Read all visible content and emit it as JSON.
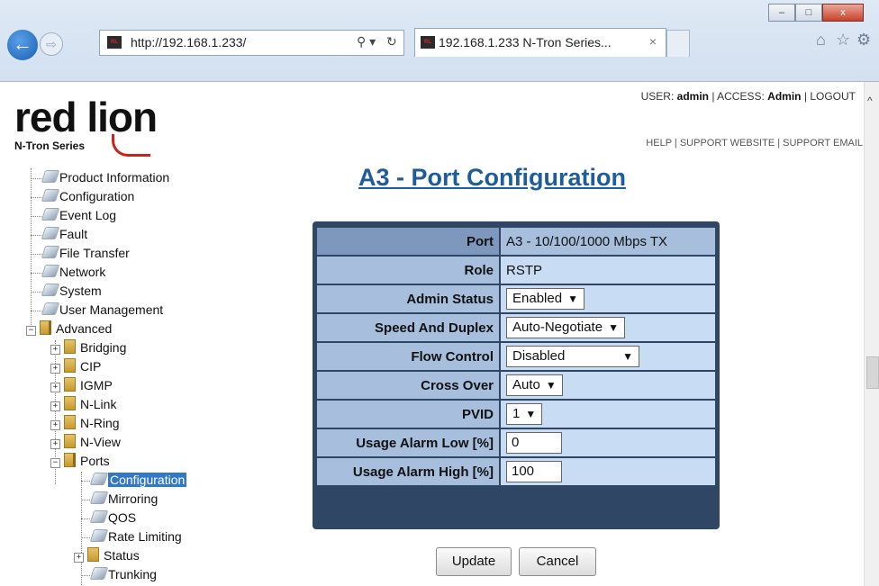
{
  "browser": {
    "url": "http://192.168.1.233/",
    "tab_title": "192.168.1.233 N-Tron Series...",
    "tab_close": "×",
    "window_controls": [
      "–",
      "□",
      "x"
    ],
    "icons": [
      "home-icon",
      "star-icon",
      "gear-icon"
    ]
  },
  "logo": {
    "brand": "red lion",
    "sub": "N-Tron Series"
  },
  "header": {
    "user_prefix": "USER:",
    "user": "admin",
    "sep1": "|",
    "access_prefix": "ACCESS:",
    "access": "Admin",
    "sep2": "|",
    "logout": "LOGOUT",
    "help": "HELP",
    "support_website": "SUPPORT WEBSITE",
    "support_email": "SUPPORT EMAIL",
    "sep": "|"
  },
  "tree": {
    "items": [
      {
        "label": "Product Information"
      },
      {
        "label": "Configuration"
      },
      {
        "label": "Event Log"
      },
      {
        "label": "Fault"
      },
      {
        "label": "File Transfer"
      },
      {
        "label": "Network"
      },
      {
        "label": "System"
      },
      {
        "label": "User Management"
      },
      {
        "label": "Advanced"
      },
      {
        "label": "Bridging"
      },
      {
        "label": "CIP"
      },
      {
        "label": "IGMP"
      },
      {
        "label": "N-Link"
      },
      {
        "label": "N-Ring"
      },
      {
        "label": "N-View"
      },
      {
        "label": "Ports"
      },
      {
        "label": "Configuration"
      },
      {
        "label": "Mirroring"
      },
      {
        "label": "QOS"
      },
      {
        "label": "Rate Limiting"
      },
      {
        "label": "Status"
      },
      {
        "label": "Trunking"
      }
    ]
  },
  "page": {
    "title": "A3 - Port Configuration"
  },
  "config": {
    "rows": [
      {
        "label": "Port",
        "value": "A3 - 10/100/1000 Mbps TX"
      },
      {
        "label": "Role",
        "value": "RSTP"
      },
      {
        "label": "Admin Status",
        "value": "Enabled"
      },
      {
        "label": "Speed And Duplex",
        "value": "Auto-Negotiate"
      },
      {
        "label": "Flow Control",
        "value": "Disabled"
      },
      {
        "label": "Cross Over",
        "value": "Auto"
      },
      {
        "label": "PVID",
        "value": "1"
      },
      {
        "label": "Usage Alarm Low [%]",
        "value": "0"
      },
      {
        "label": "Usage Alarm High [%]",
        "value": "100"
      }
    ]
  },
  "buttons": {
    "update": "Update",
    "cancel": "Cancel"
  }
}
